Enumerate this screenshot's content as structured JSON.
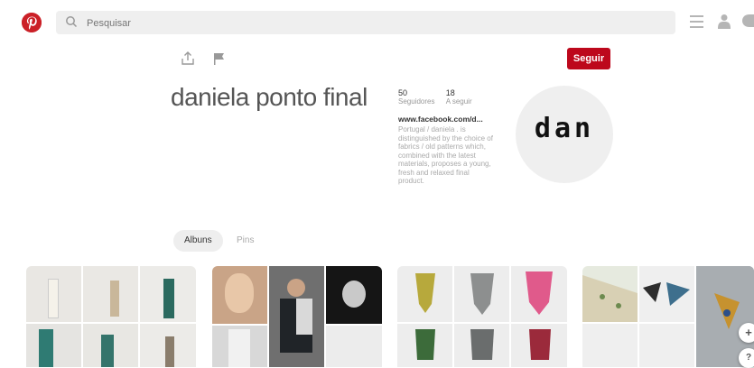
{
  "header": {
    "search_placeholder": "Pesquisar"
  },
  "profile": {
    "follow_label": "Seguir",
    "name": "daniela ponto final",
    "stats": [
      {
        "value": "50",
        "label": "Seguidores"
      },
      {
        "value": "18",
        "label": "A seguir"
      }
    ],
    "website": "www.facebook.com/d...",
    "bio": "Portugal / daniela . is distinguished by the choice of fabrics / old patterns which, combined with the latest materials, proposes a young, fresh and relaxed final product.",
    "avatar_text": "dan"
  },
  "tabs": [
    {
      "label": "Albuns",
      "active": true
    },
    {
      "label": "Pins",
      "active": false
    }
  ],
  "floating": {
    "add": "+",
    "help": "?"
  },
  "colors": {
    "brand_red": "#bd081c"
  }
}
